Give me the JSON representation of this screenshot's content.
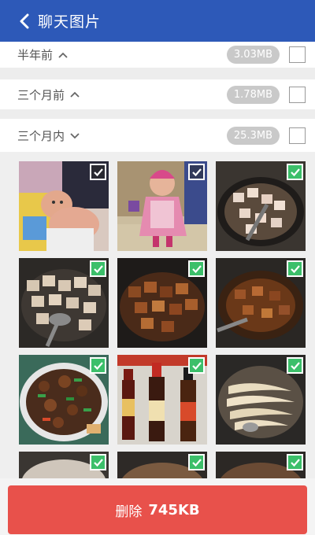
{
  "header": {
    "title": "聊天图片"
  },
  "sections": [
    {
      "label": "半年前",
      "size": "3.03MB",
      "arrow": "up"
    },
    {
      "label": "三个月前",
      "size": "1.78MB",
      "arrow": "up"
    },
    {
      "label": "三个月内",
      "size": "25.3MB",
      "arrow": "down"
    }
  ],
  "colors": {
    "header": "#2d59b8",
    "delete": "#e8514b",
    "check": "#3cbf6a"
  },
  "grid": {
    "tiles": [
      {
        "subject": "baby-photo",
        "checked": true,
        "check_style": "translucent"
      },
      {
        "subject": "toddler-photo",
        "checked": true,
        "check_style": "translucent"
      },
      {
        "subject": "pork-in-wok",
        "checked": true,
        "check_style": "green"
      },
      {
        "subject": "pork-pieces",
        "checked": true,
        "check_style": "green"
      },
      {
        "subject": "braised-pork",
        "checked": true,
        "check_style": "green"
      },
      {
        "subject": "stew-in-wok",
        "checked": true,
        "check_style": "green"
      },
      {
        "subject": "finished-dish",
        "checked": true,
        "check_style": "green"
      },
      {
        "subject": "sauce-bottles",
        "checked": true,
        "check_style": "green"
      },
      {
        "subject": "fish-in-wok",
        "checked": true,
        "check_style": "green"
      },
      {
        "subject": "dish-partial-1",
        "checked": true,
        "check_style": "green"
      },
      {
        "subject": "dish-partial-2",
        "checked": true,
        "check_style": "green"
      },
      {
        "subject": "dish-partial-3",
        "checked": true,
        "check_style": "green"
      }
    ]
  },
  "footer": {
    "delete_label": "删除",
    "delete_size": "745KB"
  }
}
